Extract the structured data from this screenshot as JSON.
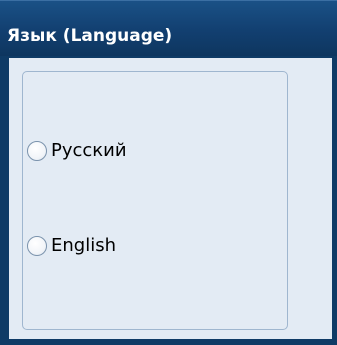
{
  "panel": {
    "title": "Язык (Language)"
  },
  "language_options": [
    {
      "label": "Русский",
      "selected": false
    },
    {
      "label": "English",
      "selected": false
    }
  ],
  "colors": {
    "header_background": "#123f70",
    "header_text": "#ffffff",
    "body_background": "#e3ebf4",
    "group_border": "#9fb6cf",
    "radio_border": "#7b93ad",
    "label_text": "#000000"
  }
}
